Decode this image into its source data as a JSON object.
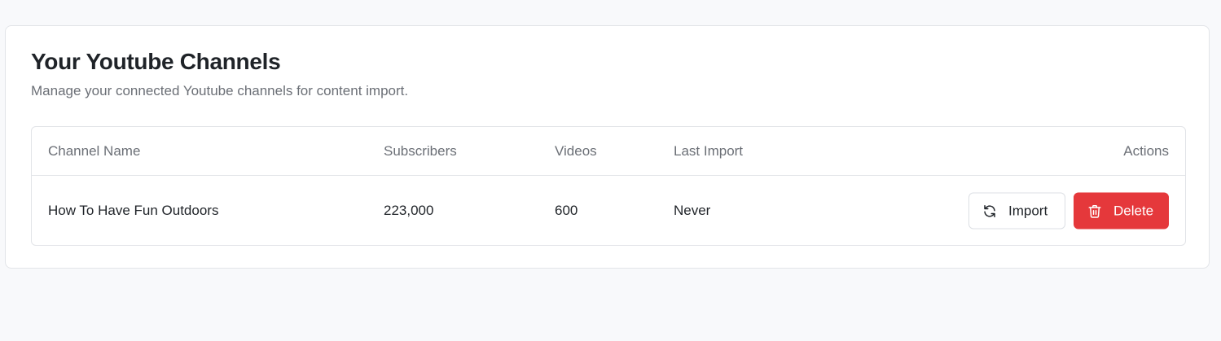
{
  "header": {
    "title": "Your Youtube Channels",
    "subtitle": "Manage your connected Youtube channels for content import."
  },
  "table": {
    "columns": {
      "name": "Channel Name",
      "subscribers": "Subscribers",
      "videos": "Videos",
      "last_import": "Last Import",
      "actions": "Actions"
    },
    "rows": [
      {
        "name": "How To Have Fun Outdoors",
        "subscribers": "223,000",
        "videos": "600",
        "last_import": "Never",
        "import_label": "Import",
        "delete_label": "Delete"
      }
    ]
  },
  "icons": {
    "import": "refresh-icon",
    "delete": "trash-icon"
  },
  "colors": {
    "delete_button": "#e5383b",
    "page_background": "#f8f9fb"
  }
}
